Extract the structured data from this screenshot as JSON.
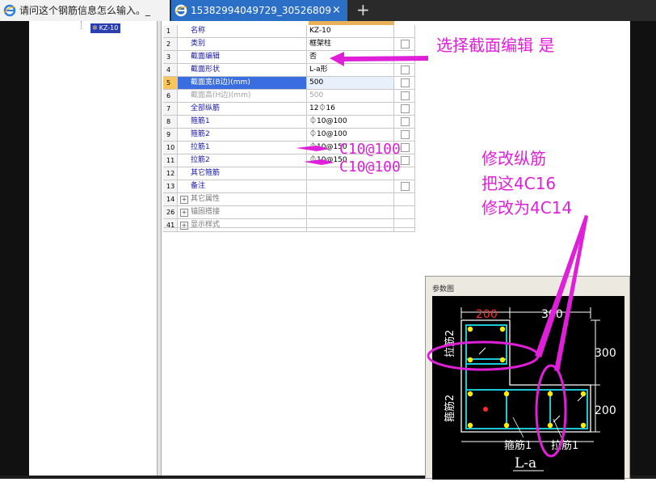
{
  "browser": {
    "tabs": [
      {
        "title": "请问这个钢筋信息怎么输入。_",
        "active": false
      },
      {
        "title": "15382994049729_30526809",
        "active": true
      }
    ],
    "close_glyph": "×",
    "new_tab_glyph": "+"
  },
  "tree": {
    "item": "KZ-10"
  },
  "grid": {
    "rows": [
      {
        "num": "1",
        "name": "名称",
        "value": "KZ-10",
        "checkbox": false
      },
      {
        "num": "2",
        "name": "类别",
        "value": "框架柱",
        "checkbox": true
      },
      {
        "num": "3",
        "name": "截面编辑",
        "value": "否",
        "checkbox": false
      },
      {
        "num": "4",
        "name": "截面形状",
        "value": "L-a形",
        "checkbox": true
      },
      {
        "num": "5",
        "name": "截面宽(B边)(mm)",
        "value": "500",
        "checkbox": true
      },
      {
        "num": "6",
        "name": "截面高(H边)(mm)",
        "value": "500",
        "checkbox": true
      },
      {
        "num": "7",
        "name": "全部纵筋",
        "value": "12⏀16",
        "checkbox": true
      },
      {
        "num": "8",
        "name": "箍筋1",
        "value": "⏀10@100",
        "checkbox": true
      },
      {
        "num": "9",
        "name": "箍筋2",
        "value": "⏀10@100",
        "checkbox": true
      },
      {
        "num": "10",
        "name": "拉筋1",
        "value": "⏀10@150",
        "checkbox": true
      },
      {
        "num": "11",
        "name": "拉筋2",
        "value": "⏀10@150",
        "checkbox": true
      },
      {
        "num": "12",
        "name": "其它箍筋",
        "value": "",
        "checkbox": false
      },
      {
        "num": "13",
        "name": "备注",
        "value": "",
        "checkbox": true
      },
      {
        "num": "14",
        "name": "其它属性",
        "value": "",
        "checkbox": false
      },
      {
        "num": "26",
        "name": "锚固搭接",
        "value": "",
        "checkbox": false
      },
      {
        "num": "41",
        "name": "显示样式",
        "value": "",
        "checkbox": false
      }
    ],
    "expand_glyph": "+"
  },
  "annotations": {
    "select_edit": "选择截面编辑   是",
    "modify_line1": "修改纵筋",
    "modify_line2": "把这4C16",
    "modify_line3": "修改为4C14",
    "c10_1": "C10@100",
    "c10_2": "C10@100"
  },
  "param_panel": {
    "title": "参数图",
    "dim_top_left": "200",
    "dim_top_right": "300",
    "dim_right_top": "300",
    "dim_right_bottom": "200",
    "label_lajin2": "拉筋2",
    "label_gujin2": "箍筋2",
    "label_gujin1": "箍筋1",
    "label_lajin1": "拉筋1",
    "shape_label": "L-a"
  },
  "colors": {
    "annotation": "#e020d8",
    "tab_active": "#2b6fc6",
    "selected_row": "#3a6ee0",
    "rebar_cyan": "#19c8d6",
    "rebar_dot": "#ffee00",
    "dim_red": "#ff2a2a"
  }
}
